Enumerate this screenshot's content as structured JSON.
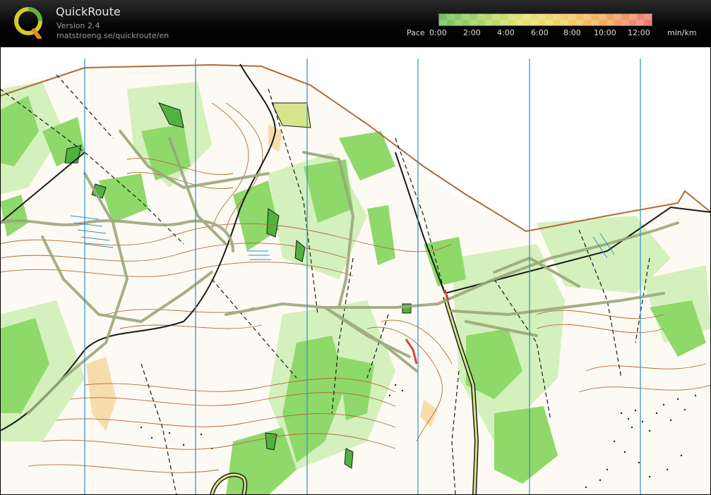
{
  "app": {
    "title": "QuickRoute",
    "version": "Version 2.4",
    "url": "matstroeng.se/quickroute/en"
  },
  "pace_scale": {
    "label": "Pace",
    "ticks": [
      "0:00",
      "2:00",
      "4:00",
      "6:00",
      "8:00",
      "10:00",
      "12:00"
    ],
    "unit": "min/km",
    "colors": {
      "fast": "#6fbf5b",
      "mid": "#e6e46e",
      "slow": "#ee7777"
    }
  },
  "map": {
    "colors": {
      "vegetation": "#8fd86a",
      "vegetation_light": "#d4f0bd",
      "contour": "#b06a3a",
      "road": "#1a1a1a",
      "route": "#9ba77b",
      "north_line": "#2a8fc8",
      "marsh": "#2a8fc8",
      "open_land": "#f6d69a"
    }
  }
}
